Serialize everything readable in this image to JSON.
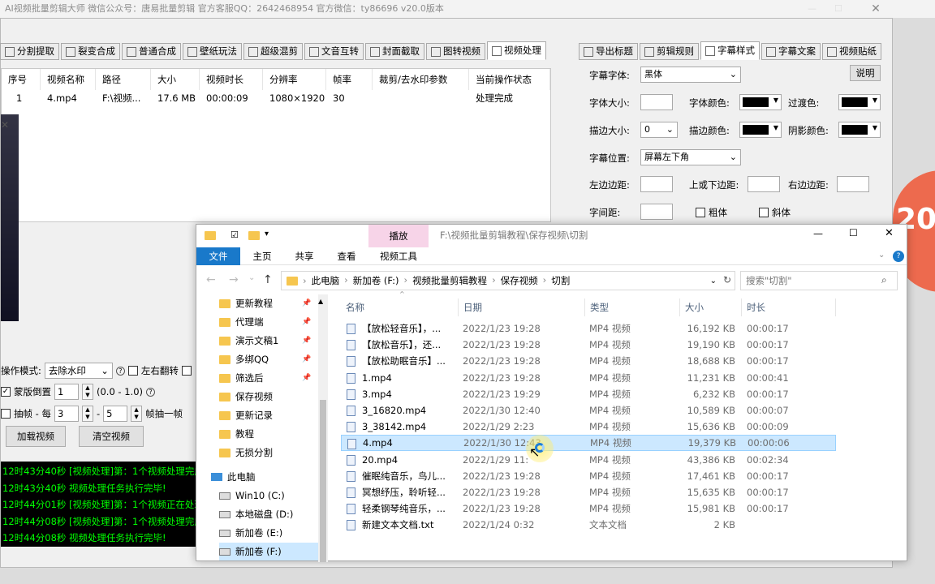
{
  "app": {
    "title": "AI视频批量剪辑大师  微信公众号：唐易批量剪辑  官方客服QQ：2642468954  官方微信：ty86696  v20.0版本",
    "close": "✕",
    "left_tabs": [
      {
        "label": "分割提取",
        "icon": "split-icon"
      },
      {
        "label": "裂变合成",
        "icon": "merge-icon"
      },
      {
        "label": "普通合成",
        "icon": "play-icon"
      },
      {
        "label": "壁纸玩法",
        "icon": "wallpaper-icon"
      },
      {
        "label": "超级混剪",
        "icon": "mix-icon"
      },
      {
        "label": "文音互转",
        "icon": "audio-icon"
      },
      {
        "label": "封面截取",
        "icon": "cover-icon"
      },
      {
        "label": "图转视频",
        "icon": "image-icon"
      },
      {
        "label": "视频处理",
        "icon": "video-icon"
      }
    ],
    "right_tabs": [
      {
        "label": "导出标题",
        "icon": "export-icon"
      },
      {
        "label": "剪辑规则",
        "icon": "rules-icon"
      },
      {
        "label": "字幕样式",
        "icon": "subtitle-icon"
      },
      {
        "label": "字幕文案",
        "icon": "edit-icon"
      },
      {
        "label": "视频贴纸",
        "icon": "sticker-icon"
      }
    ],
    "table": {
      "headers": [
        "序号",
        "视频名称",
        "路径",
        "大小",
        "视频时长",
        "分辨率",
        "帧率",
        "裁剪/去水印参数",
        "当前操作状态"
      ],
      "rows": [
        [
          "1",
          "4.mp4",
          "F:\\视频...",
          "17.6 MB",
          "00:00:09",
          "1080×1920",
          "30",
          "",
          "处理完成"
        ]
      ]
    },
    "controls": {
      "mode_label": "操作模式:",
      "mode_value": "去除水印",
      "flip_label": "左右翻转",
      "mask_label": "蒙版倒置",
      "mask_value": "1",
      "mask_range": "(0.0 - 1.0)",
      "mask_checked": true,
      "frame_label": "抽帧 - 每",
      "frame_from": "3",
      "frame_dash": "-",
      "frame_to": "5",
      "frame_suffix": "帧抽一帧",
      "load_button": "加载视频",
      "clear_button": "清空视频"
    },
    "log": [
      "12时43分40秒 [视频处理]第：1个视频处理完成",
      "12时43分40秒 视频处理任务执行完毕!",
      "12时44分01秒 [视频处理]第：1个视频正在处理",
      "12时44分08秒 [视频处理]第：1个视频处理完成",
      "12时44分08秒 视频处理任务执行完毕!"
    ],
    "subtitle_panel": {
      "font_label": "字幕字体:",
      "font_value": "黑体",
      "help_button": "说明",
      "size_label": "字体大小:",
      "color_label": "字体颜色:",
      "transition_label": "过渡色:",
      "stroke_label": "描边大小:",
      "stroke_value": "0",
      "stroke_color_label": "描边颜色:",
      "shadow_label": "阴影颜色:",
      "position_label": "字幕位置:",
      "position_value": "屏幕左下角",
      "left_margin_label": "左边边距:",
      "vertical_margin_label": "上或下边距:",
      "right_margin_label": "右边边距:",
      "spacing_label": "字间距:",
      "bold_label": "粗体",
      "italic_label": "斜体"
    },
    "deco_text": "20"
  },
  "explorer": {
    "ribbon_context": "播放",
    "path_title": "F:\\视频批量剪辑教程\\保存视频\\切割",
    "tabs": [
      "文件",
      "主页",
      "共享",
      "查看",
      "视频工具"
    ],
    "breadcrumb": [
      "此电脑",
      "新加卷 (F:)",
      "视频批量剪辑教程",
      "保存视频",
      "切割"
    ],
    "search_placeholder": "搜索\"切割\"",
    "nav_items": [
      {
        "label": "更新教程",
        "pinned": true
      },
      {
        "label": "代理端",
        "pinned": true
      },
      {
        "label": "演示文稿1",
        "pinned": true
      },
      {
        "label": "多绑QQ",
        "pinned": true
      },
      {
        "label": "筛选后",
        "pinned": true
      },
      {
        "label": "保存视频",
        "pinned": false
      },
      {
        "label": "更新记录",
        "pinned": false
      },
      {
        "label": "教程",
        "pinned": false
      },
      {
        "label": "无损分割",
        "pinned": false
      }
    ],
    "pc_label": "此电脑",
    "drives": [
      "Win10 (C:)",
      "本地磁盘 (D:)",
      "新加卷 (E:)",
      "新加卷 (F:)"
    ],
    "columns": [
      "名称",
      "日期",
      "类型",
      "大小",
      "时长"
    ],
    "files": [
      {
        "name": "【放松轻音乐】，...",
        "date": "2022/1/23 19:28",
        "type": "MP4 视频",
        "size": "16,192 KB",
        "duration": "00:00:17"
      },
      {
        "name": "【放松音乐】，还...",
        "date": "2022/1/23 19:28",
        "type": "MP4 视频",
        "size": "19,190 KB",
        "duration": "00:00:17"
      },
      {
        "name": "【放松助眠音乐】...",
        "date": "2022/1/23 19:28",
        "type": "MP4 视频",
        "size": "18,688 KB",
        "duration": "00:00:17"
      },
      {
        "name": "1.mp4",
        "date": "2022/1/23 19:28",
        "type": "MP4 视频",
        "size": "11,231 KB",
        "duration": "00:00:41"
      },
      {
        "name": "3.mp4",
        "date": "2022/1/23 19:29",
        "type": "MP4 视频",
        "size": "6,232 KB",
        "duration": "00:00:17"
      },
      {
        "name": "3_16820.mp4",
        "date": "2022/1/30 12:40",
        "type": "MP4 视频",
        "size": "10,589 KB",
        "duration": "00:00:07"
      },
      {
        "name": "3_38142.mp4",
        "date": "2022/1/29 2:23",
        "type": "MP4 视频",
        "size": "15,636 KB",
        "duration": "00:00:09"
      },
      {
        "name": "4.mp4",
        "date": "2022/1/30 12:43",
        "type": "MP4 视频",
        "size": "19,379 KB",
        "duration": "00:00:06",
        "selected": true
      },
      {
        "name": "20.mp4",
        "date": "2022/1/29 11:",
        "type": "MP4 视频",
        "size": "43,386 KB",
        "duration": "00:02:34"
      },
      {
        "name": "催眠纯音乐，鸟儿...",
        "date": "2022/1/23 19:28",
        "type": "MP4 视频",
        "size": "17,461 KB",
        "duration": "00:00:17"
      },
      {
        "name": "冥想纾压，聆听轻...",
        "date": "2022/1/23 19:28",
        "type": "MP4 视频",
        "size": "15,635 KB",
        "duration": "00:00:17"
      },
      {
        "name": "轻柔钢琴纯音乐，...",
        "date": "2022/1/23 19:28",
        "type": "MP4 视频",
        "size": "15,981 KB",
        "duration": "00:00:17"
      },
      {
        "name": "新建文本文档.txt",
        "date": "2022/1/24 0:32",
        "type": "文本文档",
        "size": "2 KB",
        "duration": ""
      }
    ]
  }
}
